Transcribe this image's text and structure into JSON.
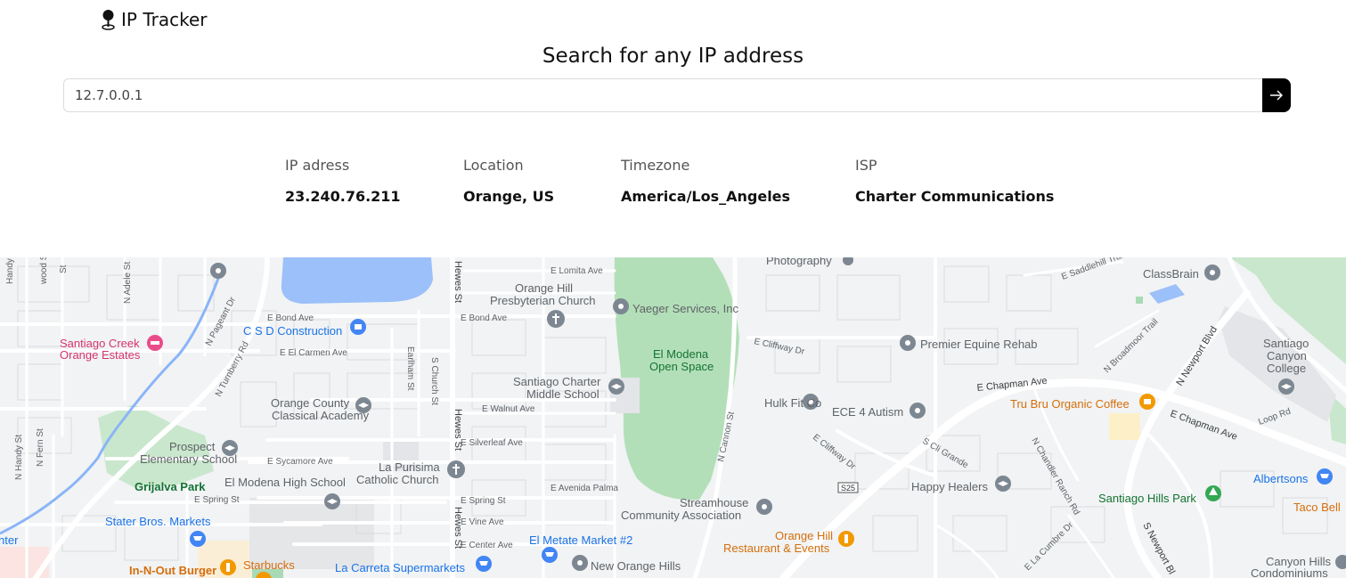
{
  "header": {
    "logo_icon": "map-pin-icon",
    "title": "IP Tracker"
  },
  "search": {
    "heading": "Search for any IP address",
    "input_value": "12.7.0.0.1",
    "submit_icon": "arrow-right-icon"
  },
  "info": {
    "ip_label": "IP adress",
    "ip_value": "23.240.76.211",
    "location_label": "Location",
    "location_value": "Orange, US",
    "timezone_label": "Timezone",
    "timezone_value": "America/Los_Angeles",
    "isp_label": "ISP",
    "isp_value": "Charter Communications"
  },
  "map": {
    "pois": {
      "santiago_creek": [
        "Santiago Creek",
        "Orange Estates"
      ],
      "csd": "C S D Construction",
      "orange_county_academy": [
        "Orange County",
        "Classical Academy"
      ],
      "prospect": [
        "Prospect",
        "Elementary School"
      ],
      "grijalva": "Grijalva Park",
      "el_modena_hs": "El Modena High School",
      "stater": "Stater Bros. Markets",
      "in_n_out": "In-N-Out Burger",
      "starbucks": "Starbucks",
      "la_carreta": "La Carreta Supermarkets",
      "el_metate": "El Metate Market #2",
      "new_orange_hills": "New Orange Hills",
      "orange_hill_church": [
        "Orange Hill",
        "Presbyterian Church"
      ],
      "yaeger": "Yaeger Services, Inc",
      "el_modena_open": [
        "El Modena",
        "Open Space"
      ],
      "santiago_charter": [
        "Santiago Charter",
        "Middle School"
      ],
      "la_purisima": [
        "La Purisima",
        "Catholic Church"
      ],
      "streamhouse": [
        "Streamhouse",
        "Community Association"
      ],
      "orange_hill_rest": [
        "Orange Hill",
        "Restaurant & Events"
      ],
      "hulk": "Hulk Fit Co",
      "ece": "ECE 4 Autism",
      "premier": "Premier Equine Rehab",
      "photography": "Photography",
      "classbrain": "ClassBrain",
      "tru_bru": "Tru Bru Organic Coffee",
      "happy": "Happy Healers",
      "santiago_hills_park": "Santiago Hills Park",
      "santiago_canyon": [
        "Santiago",
        "Canyon",
        "College"
      ],
      "albertsons": "Albertsons",
      "taco_bell": "Taco Bell",
      "canyon_hills": [
        "Canyon Hills",
        "Condominiums"
      ],
      "center_cut": "nter"
    },
    "streets": {
      "handy_st": "Handy St",
      "n_handy_st": "N Handy St",
      "wood_st": "wood St",
      "st": "St",
      "adele": "N Adele St",
      "pageant": "N Pageant Dr",
      "turnberry": "N Turnberry Rd",
      "fern": "N Fern St",
      "bond1": "E Bond Ave",
      "bond2": "E Bond Ave",
      "carmen": "E El Carmen Ave",
      "earlham": "Earlham St",
      "church": "S Church St",
      "walnut": "E Walnut Ave",
      "silverleaf": "E Silverleaf Ave",
      "sycamore": "E Sycamore Ave",
      "spring1": "E Spring St",
      "spring2": "E Spring St",
      "vine": "E Vine Ave",
      "center_ave": "E Center Ave",
      "hewes": "Hewes St",
      "lomita": "E Lomita Ave",
      "palma": "E Avenida Palma",
      "cannon": "N Cannon St",
      "cliffway1": "E Cliffway Dr",
      "cliffway2": "E Cliffway Dr",
      "chapman1": "E Chapman Ave",
      "chapman2": "E Chapman Ave",
      "cli_grande": "S Cli Grande",
      "chandler": "N Chandler Ranch Rd",
      "broadmoor": "N Broadmoor Trail",
      "saddlehill": "E Saddlehill Trail",
      "newport": "N Newport Blvd",
      "s_newport": "S Newport Bl",
      "la_cumbre": "E La Cumbre Dr",
      "loop": "Loop Rd",
      "s25": "S25"
    }
  }
}
